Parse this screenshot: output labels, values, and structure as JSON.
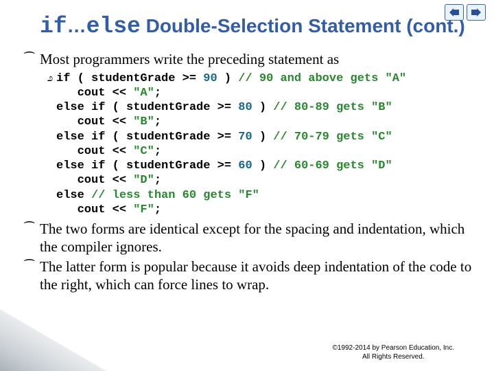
{
  "nav": {
    "prev_icon": "arrow-left-icon",
    "next_icon": "arrow-right-icon"
  },
  "title": {
    "kw_if": "if",
    "ellipsis": "…",
    "kw_else": "else",
    "rest": " Double-Selection Statement (cont.)"
  },
  "bullets": {
    "b1": "Most programmers write the preceding statement as",
    "b2": "The two forms are identical except for the spacing and indentation, which the compiler ignores.",
    "b3": "The latter form is popular because it avoids deep indentation of the code to the right, which can force lines to wrap."
  },
  "code": {
    "l1_a": "if ( studentGrade >= ",
    "l1_num": "90",
    "l1_b": " ) ",
    "l1_cmt": "// 90 and above gets \"A\"",
    "l2_a": "   cout << ",
    "l2_str": "\"A\"",
    "l2_b": ";",
    "l3_a": "else if ( studentGrade >= ",
    "l3_num": "80",
    "l3_b": " ) ",
    "l3_cmt": "// 80-89 gets \"B\"",
    "l4_a": "   cout << ",
    "l4_str": "\"B\"",
    "l4_b": ";",
    "l5_a": "else if ( studentGrade >= ",
    "l5_num": "70",
    "l5_b": " ) ",
    "l5_cmt": "// 70-79 gets \"C\"",
    "l6_a": "   cout << ",
    "l6_str": "\"C\"",
    "l6_b": ";",
    "l7_a": "else if ( studentGrade >= ",
    "l7_num": "60",
    "l7_b": " ) ",
    "l7_cmt": "// 60-69 gets \"D\"",
    "l8_a": "   cout << ",
    "l8_str": "\"D\"",
    "l8_b": ";",
    "l9_a": "else ",
    "l9_cmt": "// less than 60 gets \"F\"",
    "l10_a": "   cout << ",
    "l10_str": "\"F\"",
    "l10_b": ";"
  },
  "footer": {
    "line1": "©1992-2014 by Pearson Education, Inc.",
    "line2": "All Rights Reserved."
  }
}
